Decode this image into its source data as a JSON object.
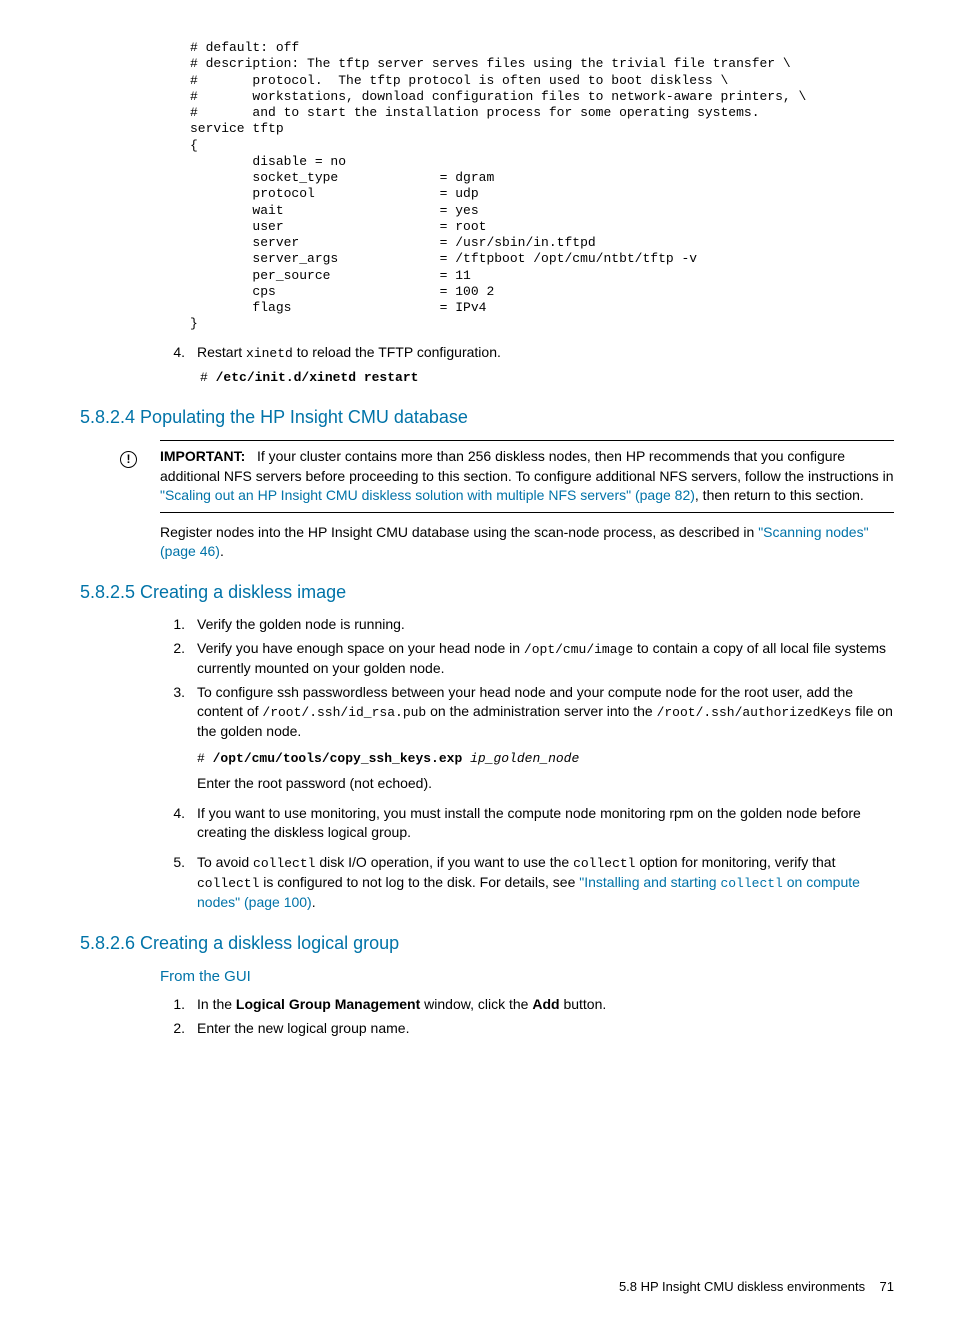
{
  "code_block": "# default: off\n# description: The tftp server serves files using the trivial file transfer \\\n#       protocol.  The tftp protocol is often used to boot diskless \\\n#       workstations, download configuration files to network-aware printers, \\\n#       and to start the installation process for some operating systems.\nservice tftp\n{\n        disable = no\n        socket_type             = dgram\n        protocol                = udp\n        wait                    = yes\n        user                    = root\n        server                  = /usr/sbin/in.tftpd\n        server_args             = /tftpboot /opt/cmu/ntbt/tftp -v\n        per_source              = 11\n        cps                     = 100 2\n        flags                   = IPv4\n}",
  "step4": {
    "num": "4.",
    "text_a": "Restart ",
    "text_b": "xinetd",
    "text_c": " to reload the TFTP configuration.",
    "cmd_a": "# ",
    "cmd_b": "/etc/init.d/xinetd restart"
  },
  "sec5824": {
    "title": "5.8.2.4 Populating the HP Insight CMU database",
    "important_label": "IMPORTANT:",
    "important_a": "If your cluster contains more than 256 diskless nodes, then HP recommends that you configure additional NFS servers before proceeding to this section. To configure additional NFS servers, follow the instructions in ",
    "important_link": "\"Scaling out an HP Insight CMU diskless solution with multiple NFS servers\" (page 82)",
    "important_b": ", then return to this section.",
    "post_a": "Register nodes into the HP Insight CMU database using the scan-node process, as described in ",
    "post_link": "\"Scanning nodes\" (page 46)",
    "post_b": "."
  },
  "sec5825": {
    "title": "5.8.2.5 Creating a diskless image",
    "s1": {
      "num": "1.",
      "text": "Verify the golden node is running."
    },
    "s2": {
      "num": "2.",
      "a": "Verify you have enough space on your head node in ",
      "b": "/opt/cmu/image",
      "c": " to contain a copy of all local file systems currently mounted on your golden node."
    },
    "s3": {
      "num": "3.",
      "a": "To configure ssh passwordless between your head node and your compute node for the root user, add the content of ",
      "b": "/root/.ssh/id_rsa.pub",
      "c": " on the administration server into the ",
      "d": "/root/.ssh/authorizedKeys",
      "e": " file on the golden node.",
      "cmd_a": "# ",
      "cmd_b": "/opt/cmu/tools/copy_ssh_keys.exp ",
      "cmd_c": "ip_golden_node",
      "after": "Enter the root password (not echoed)."
    },
    "s4": {
      "num": "4.",
      "text": "If you want to use monitoring, you must install the compute node monitoring rpm on the golden node before creating the diskless logical group."
    },
    "s5": {
      "num": "5.",
      "a": "To avoid ",
      "b": "collectl",
      "c": " disk I/O operation, if you want to use the ",
      "d": "collectl",
      "e": " option for monitoring, verify that ",
      "f": "collectl",
      "g": " is configured to not log to the disk. For details, see ",
      "link_a": "\"Installing and starting ",
      "link_b": "collectl",
      "link_c": " on compute nodes\" (page 100)",
      "h": "."
    }
  },
  "sec5826": {
    "title": "5.8.2.6 Creating a diskless logical group",
    "sub": "From the GUI",
    "s1": {
      "num": "1.",
      "a": "In the ",
      "b": "Logical Group Management",
      "c": " window, click the ",
      "d": "Add",
      "e": " button."
    },
    "s2": {
      "num": "2.",
      "text": "Enter the new logical group name."
    }
  },
  "footer": {
    "text": "5.8 HP Insight CMU diskless environments",
    "page": "71"
  }
}
